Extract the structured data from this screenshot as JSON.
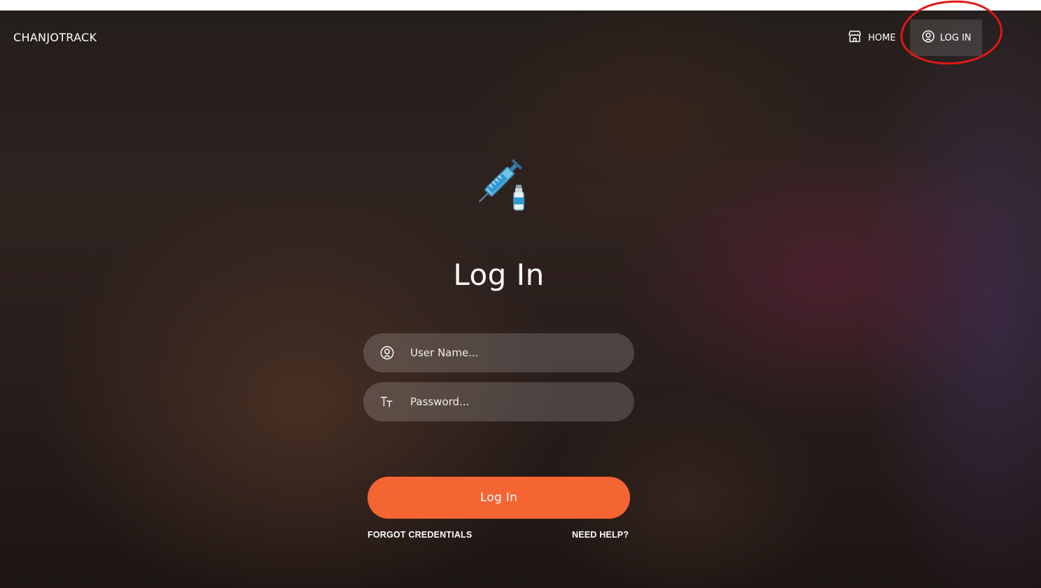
{
  "brand": "CHANJOTRACK",
  "nav": {
    "home_label": "HOME",
    "login_label": "LOG IN"
  },
  "page": {
    "title": "Log In",
    "icon": "syringe-vaccine-icon"
  },
  "form": {
    "username_placeholder": "User Name...",
    "password_placeholder": "Password...",
    "submit_label": "Log In",
    "forgot_label": "FORGOT CREDENTIALS",
    "help_label": "NEED HELP?"
  },
  "colors": {
    "accent": "#f56533",
    "annotation": "#e01717"
  }
}
